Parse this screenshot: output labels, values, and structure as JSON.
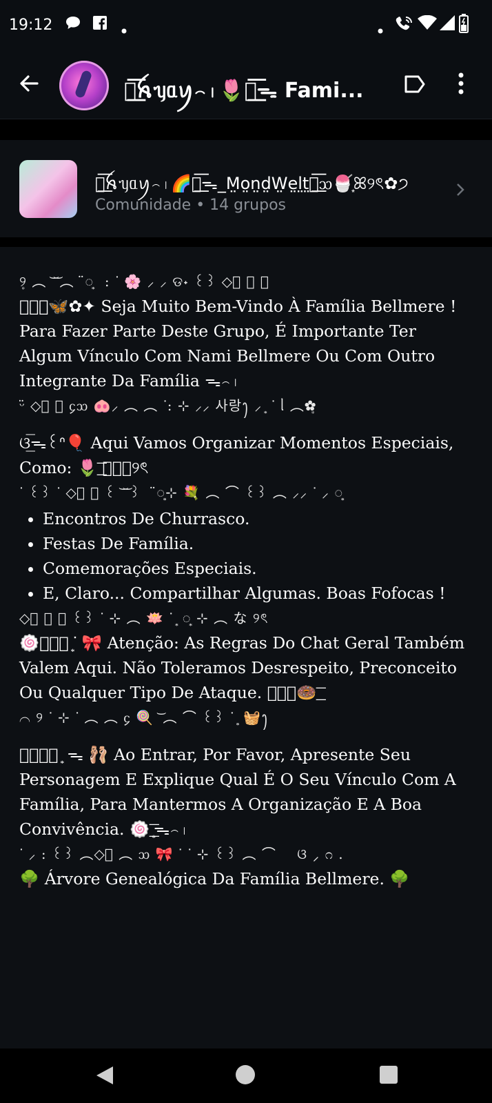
{
  "status_bar": {
    "time": "19:12",
    "icons": [
      "chat-bubble-icon",
      "facebook-icon",
      "dot-icon",
      "wifi-calling-icon",
      "wifi-icon",
      "signal-icon",
      "battery-icon"
    ]
  },
  "header": {
    "title": "ᯓ͟͞ꫝᥡᥲꪗ꤮꤯🌷ᯓ͟͞ᯓ Fami...",
    "actions": [
      "back-icon",
      "label-icon",
      "more-vert-icon"
    ]
  },
  "community": {
    "name": "ᯓ͟͞ꫝᥡᥲꪗ꤮꤯🌈ᯓ͟͞ᯓ_M̤o̤n̤d̤W̤e̤l̤t̤ᯓ͟͞ᦉ🍧͙ꕤ୨ৎ✿੭",
    "subtitle": "Comunidade • 14 grupos"
  },
  "description": {
    "deco1": "୨͙ ︵ ͝ ͝ ︵⠀̈◌͙⠀: ᐝ 🌸 ⸝ ⸝ ଡ˖ ꒰꒱ ◇͙ ︵ ︵ ⠀",
    "para1": "ᯓ͟͞🦋✿✦ Seja Muito Bem-Vindo À Família Bellmere ! Para Fazer Parte Deste Grupo, É Importante Ter Algum Vínculo Com Nami Bellmere Ou Com Outro Integrante Da Família ᯓ꤮꤯",
    "deco2": "ᵕ̈ ◇͙ ⌒ ᧔ᦉ 🐽⸝ ︵ ︵ ᐝ: ⊹ ⸝⸝ 사랑ꫂ ⸝ ͙ ᐝ ᥣ ︵✿͙",
    "para2": "ଓ͟͞ᯓ꒰ᐢ🎈 Aqui Vamos Organizar Momentos Especiais, Como: 🌷͟͞ ᯓ͟͞୨ৎ",
    "deco3": "ᐝ ꒰꒱ ᐝ ◇͙ ︵ ꒰ ͝ ͝ ꒱ ⠀̈◌͙⊹ 💐 ︵ ⌒ ꒰꒱ ︵ ⸝⸝ ᐝ ⸝ ◌͙",
    "bullets": [
      "Encontros De Churrasco.",
      "Festas De Família.",
      "Comemorações Especiais.",
      "E, Claro... Compartilhar Algumas. Boas Fofocas !"
    ],
    "deco4": "◇͙ ︵ ︵ ꒰꒱ ᐝ ⊹ ︵ 🪷 ᐝ ͙ ◌͙ ⊹ ︵ な ୨ৎ",
    "para3": "🍥ᯓ͟͞ ͙ᐝ 🎀 Atenção: As Regras Do Chat Geral Também Valem Aqui. Não Toleramos Desrespeito, Preconceito Ou Qualquer Tipo De Ataque. ᯓ͟͞🍩͟͞",
    "deco5": "⌒ ୨ ᐝ ⊹ ᐝ ︵ ︵ ᧔ 🍭 ͝ ︵ ⌒ ꒰꒱ ᐝ ͙ 🧺ꫂ",
    "para4": "ᯓ͟͞✧ ͙ ᯓ 🩰 Ao Entrar, Por Favor, Apresente Seu Personagem E Explique Qual É O Seu Vínculo Com A Família, Para Mantermos A Organização E A Boa Convivência. 🍥͟͞ ͙ᯓ꤮꤯",
    "deco6": "ᐝ ⸝ : ꒰꒱ ︵◇͙ ︵ ᦉ 🎀 ᐝ ᐝ ⊹ ꒰꒱ ︵ ⌒ ⠀ ଓ ⸝ ೧ .",
    "footer": "🌳 Árvore Genealógica Da Família Bellmere. 🌳"
  },
  "nav_bar": [
    "nav-back-icon",
    "nav-home-icon",
    "nav-recents-icon"
  ]
}
